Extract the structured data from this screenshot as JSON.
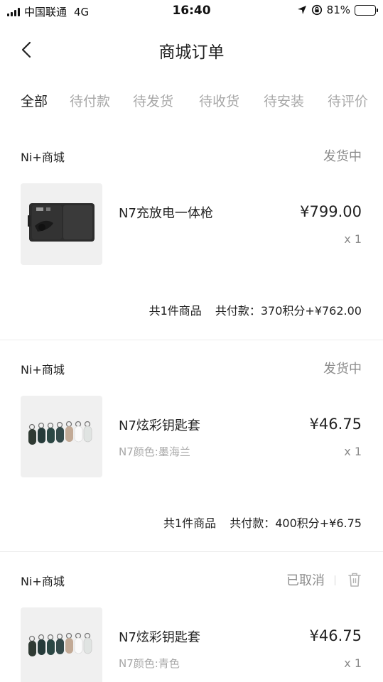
{
  "status_bar": {
    "carrier": "中国联通",
    "network": "4G",
    "time": "16:40",
    "battery": "81%",
    "battery_level": 0.81,
    "icons": [
      "signal-icon",
      "location-arrow-icon",
      "orientation-lock-icon",
      "battery-icon"
    ]
  },
  "nav": {
    "title": "商城订单",
    "back_icon": "chevron-left-icon"
  },
  "tabs": [
    {
      "label": "全部",
      "active": true
    },
    {
      "label": "待付款",
      "active": false
    },
    {
      "label": "待发货",
      "active": false
    },
    {
      "label": "待收货",
      "active": false
    },
    {
      "label": "待安装",
      "active": false
    },
    {
      "label": "待评价",
      "active": false
    }
  ],
  "orders": [
    {
      "shop": "Ni+商城",
      "status": "发货中",
      "product_name": "N7充放电一体枪",
      "product_spec": "",
      "price": "¥799.00",
      "quantity": "x 1",
      "summary_count": "共1件商品",
      "summary_paid": "共付款：370积分+¥762.00",
      "image": "charging-gun-case-image"
    },
    {
      "shop": "Ni+商城",
      "status": "发货中",
      "product_name": "N7炫彩钥匙套",
      "product_spec": "N7颜色:墨海兰",
      "price": "¥46.75",
      "quantity": "x 1",
      "summary_count": "共1件商品",
      "summary_paid": "共付款：400积分+¥6.75",
      "image": "key-fob-covers-image"
    },
    {
      "shop": "Ni+商城",
      "status": "已取消",
      "product_name": "N7炫彩钥匙套",
      "product_spec": "N7颜色:青色",
      "price": "¥46.75",
      "quantity": "x 1",
      "image": "key-fob-covers-image",
      "action_icon": "trash-icon"
    }
  ],
  "colors": {
    "text_primary": "#222222",
    "text_secondary": "#8c8c8c",
    "text_tertiary": "#a8a8a8",
    "thumb_bg": "#f0f0f0"
  }
}
